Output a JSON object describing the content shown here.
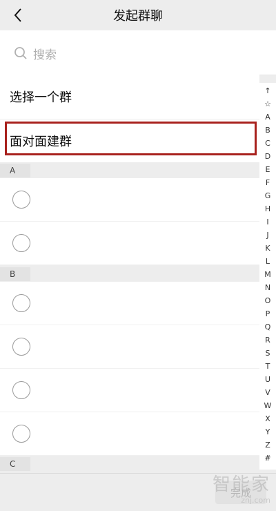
{
  "header": {
    "title": "发起群聊"
  },
  "search": {
    "placeholder": "搜索"
  },
  "rows": {
    "select_group": "选择一个群",
    "face_to_face": "面对面建群"
  },
  "sections": [
    "A",
    "B",
    "C"
  ],
  "index": [
    "↑",
    "☆",
    "A",
    "B",
    "C",
    "D",
    "E",
    "F",
    "G",
    "H",
    "I",
    "J",
    "K",
    "L",
    "M",
    "N",
    "O",
    "P",
    "Q",
    "R",
    "S",
    "T",
    "U",
    "V",
    "W",
    "X",
    "Y",
    "Z",
    "#"
  ],
  "footer": {
    "done_label": "完成"
  },
  "watermark": {
    "brand": "智能家",
    "url": "znj.com"
  },
  "colors": {
    "highlight": "#a8211d",
    "background": "#ededed"
  }
}
